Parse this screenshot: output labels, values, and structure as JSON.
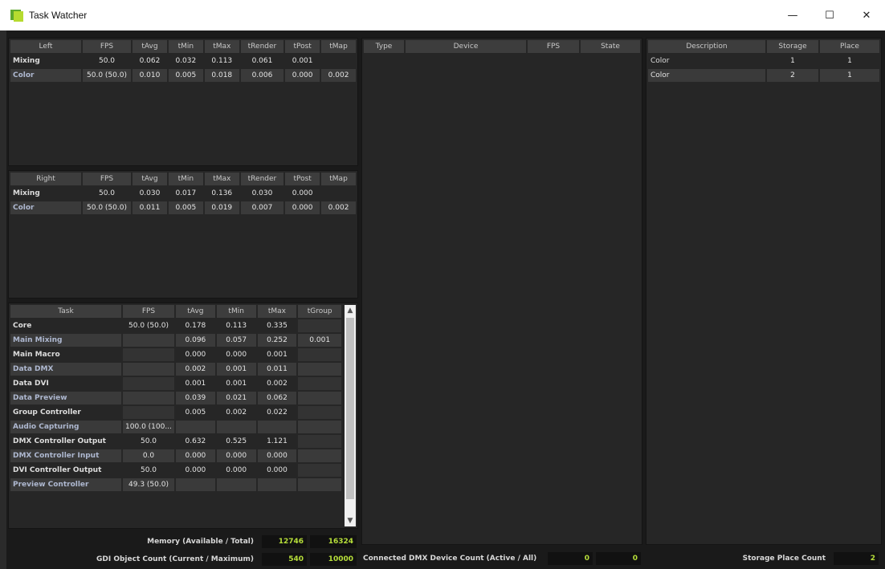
{
  "window": {
    "title": "Task Watcher",
    "minimize": "—",
    "maximize": "☐",
    "close": "✕"
  },
  "left_table": {
    "headers": [
      "Left",
      "FPS",
      "tAvg",
      "tMin",
      "tMax",
      "tRender",
      "tPost",
      "tMap"
    ],
    "rows": [
      [
        "Mixing",
        "50.0",
        "0.062",
        "0.032",
        "0.113",
        "0.061",
        "0.001",
        ""
      ],
      [
        "Color",
        "50.0 (50.0)",
        "0.010",
        "0.005",
        "0.018",
        "0.006",
        "0.000",
        "0.002"
      ]
    ]
  },
  "right_table": {
    "headers": [
      "Right",
      "FPS",
      "tAvg",
      "tMin",
      "tMax",
      "tRender",
      "tPost",
      "tMap"
    ],
    "rows": [
      [
        "Mixing",
        "50.0",
        "0.030",
        "0.017",
        "0.136",
        "0.030",
        "0.000",
        ""
      ],
      [
        "Color",
        "50.0 (50.0)",
        "0.011",
        "0.005",
        "0.019",
        "0.007",
        "0.000",
        "0.002"
      ]
    ]
  },
  "task_table": {
    "headers": [
      "Task",
      "FPS",
      "tAvg",
      "tMin",
      "tMax",
      "tGroup"
    ],
    "rows": [
      [
        "Core",
        "50.0 (50.0)",
        "0.178",
        "0.113",
        "0.335",
        ""
      ],
      [
        "Main Mixing",
        "",
        "0.096",
        "0.057",
        "0.252",
        "0.001"
      ],
      [
        "Main Macro",
        "",
        "0.000",
        "0.000",
        "0.001",
        ""
      ],
      [
        "Data DMX",
        "",
        "0.002",
        "0.001",
        "0.011",
        ""
      ],
      [
        "Data DVI",
        "",
        "0.001",
        "0.001",
        "0.002",
        ""
      ],
      [
        "Data Preview",
        "",
        "0.039",
        "0.021",
        "0.062",
        ""
      ],
      [
        "Group Controller",
        "",
        "0.005",
        "0.002",
        "0.022",
        ""
      ],
      [
        "Audio Capturing",
        "100.0 (100...",
        "",
        "",
        "",
        ""
      ],
      [
        "DMX Controller Output",
        "50.0",
        "0.632",
        "0.525",
        "1.121",
        ""
      ],
      [
        "DMX Controller Input",
        "0.0",
        "0.000",
        "0.000",
        "0.000",
        ""
      ],
      [
        "DVI Controller Output",
        "50.0",
        "0.000",
        "0.000",
        "0.000",
        ""
      ],
      [
        "Preview Controller",
        "49.3 (50.0)",
        "",
        "",
        "",
        ""
      ]
    ]
  },
  "memory": {
    "label": "Memory (Available / Total)",
    "available": "12746",
    "total": "16324"
  },
  "gdi": {
    "label": "GDI Object Count (Current / Maximum)",
    "current": "540",
    "maximum": "10000"
  },
  "device_table": {
    "headers": [
      "Type",
      "Device",
      "FPS",
      "State"
    ],
    "rows": []
  },
  "dmx_count": {
    "label": "Connected DMX Device Count (Active / All)",
    "active": "0",
    "all": "0"
  },
  "storage_table": {
    "headers": [
      "Description",
      "Storage",
      "Place"
    ],
    "rows": [
      [
        "Color",
        "1",
        "1"
      ],
      [
        "Color",
        "2",
        "1"
      ]
    ]
  },
  "storage_count": {
    "label": "Storage Place Count",
    "value": "2"
  },
  "icons": {
    "app": "app-icon",
    "scroll_up": "chevron-up-icon",
    "scroll_down": "chevron-down-icon"
  }
}
